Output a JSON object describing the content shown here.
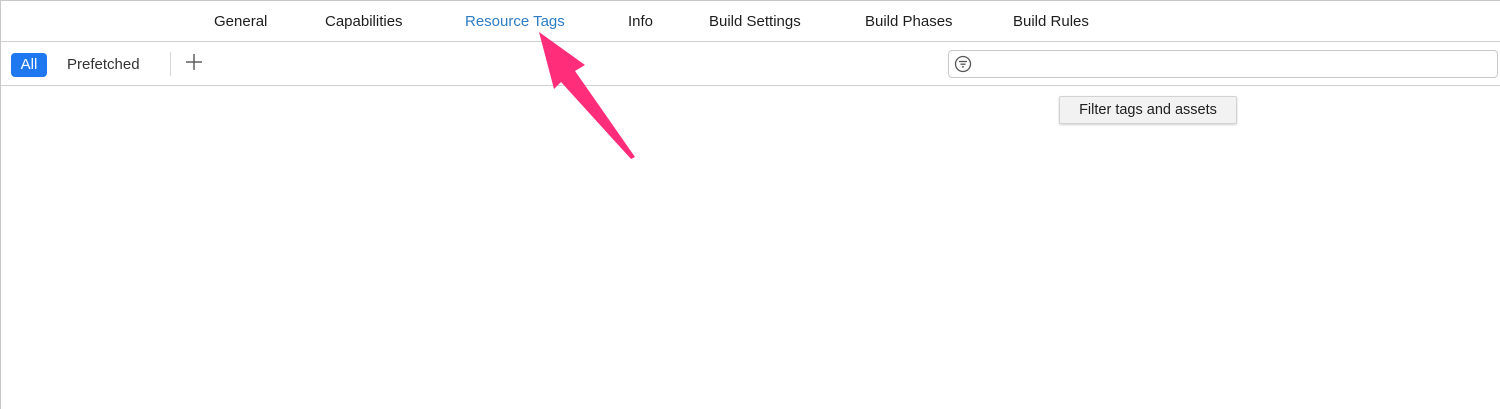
{
  "tabs": [
    {
      "label": "General"
    },
    {
      "label": "Capabilities"
    },
    {
      "label": "Resource Tags",
      "selected": true
    },
    {
      "label": "Info"
    },
    {
      "label": "Build Settings"
    },
    {
      "label": "Build Phases"
    },
    {
      "label": "Build Rules"
    }
  ],
  "toolbar": {
    "segments": [
      {
        "label": "All",
        "selected": true
      },
      {
        "label": "Prefetched"
      }
    ],
    "add_icon": "plus-icon"
  },
  "search": {
    "icon": "filter-icon",
    "value": "",
    "tooltip": "Filter tags and assets"
  },
  "annotation": {
    "icon": "arrow-icon",
    "color": "#ff2d7a"
  },
  "colors": {
    "accent": "#1f78f0",
    "selected_tab": "#2d7cc4"
  }
}
